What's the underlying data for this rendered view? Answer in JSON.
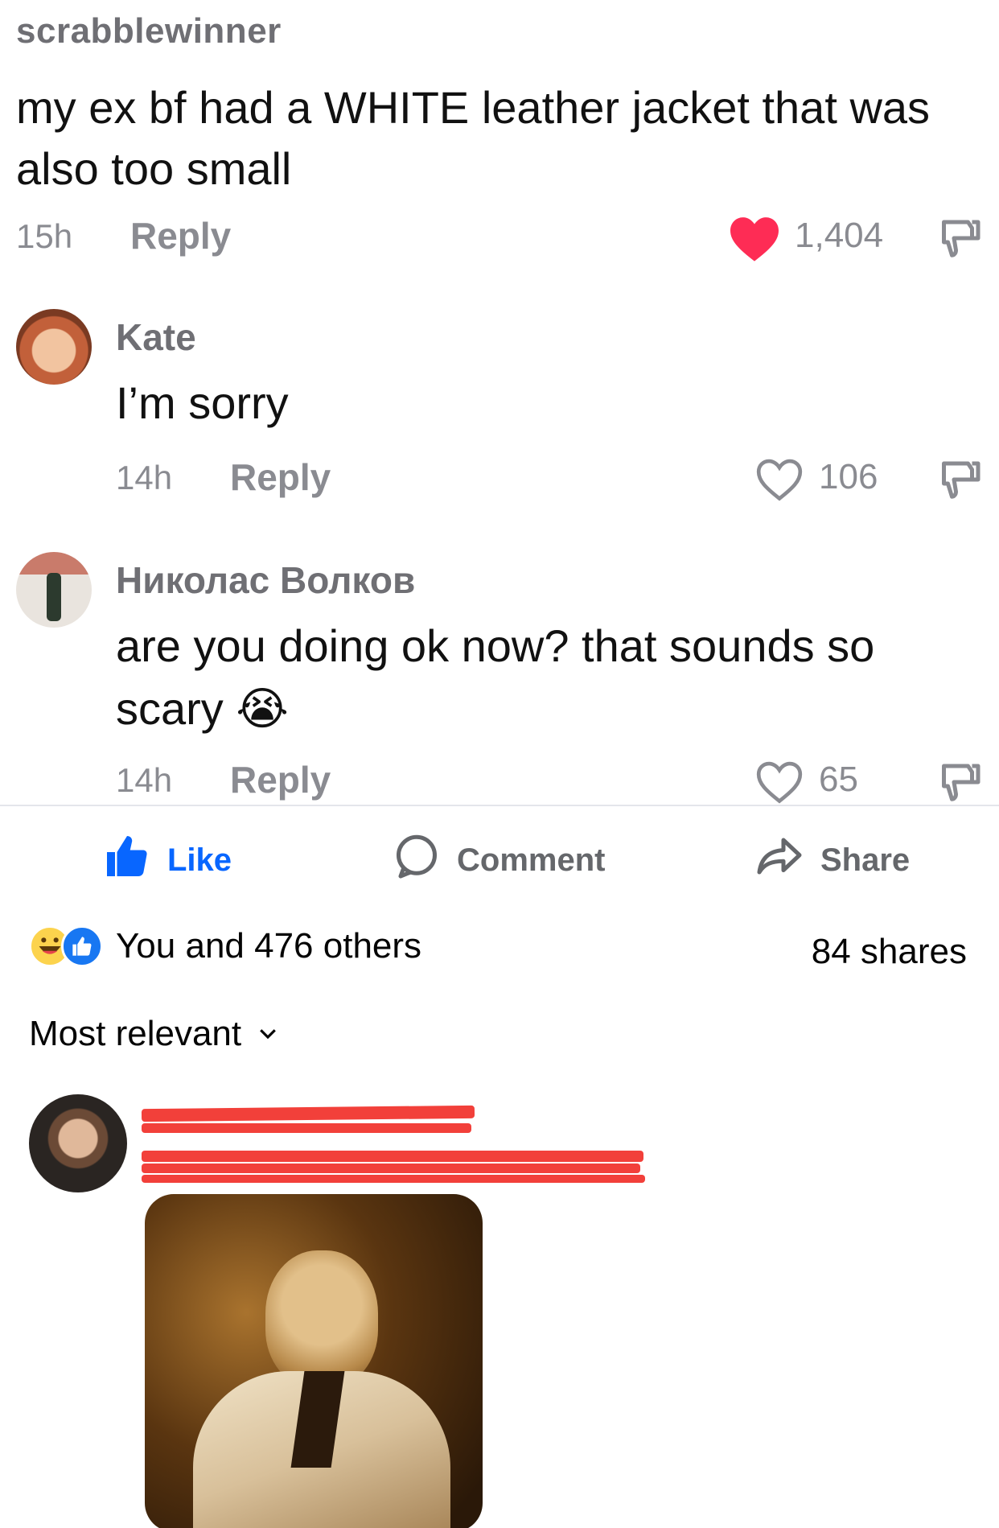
{
  "top_comment": {
    "username": "scrabblewinner",
    "text": "my ex bf had a WHITE leather jacket that was also too small",
    "time": "15h",
    "reply_label": "Reply",
    "likes": "1,404",
    "liked": true
  },
  "replies": [
    {
      "name": "Kate",
      "text": "I’m sorry",
      "time": "14h",
      "reply_label": "Reply",
      "likes": "106"
    },
    {
      "name": "Николас Волков",
      "text": "are you doing ok now? that sounds so scary",
      "emoji": "😭",
      "time": "14h",
      "reply_label": "Reply",
      "likes": "65"
    }
  ],
  "fb_actions": {
    "like": "Like",
    "comment": "Comment",
    "share": "Share"
  },
  "fb_summary": {
    "reactions_text": "You and 476 others",
    "shares_text": "84 shares"
  },
  "fb_sort": {
    "label": "Most relevant"
  },
  "colors": {
    "heart_red": "#fe2c55",
    "fb_blue": "#0866ff",
    "muted": "#8a8b91",
    "redaction": "#f2403a"
  }
}
